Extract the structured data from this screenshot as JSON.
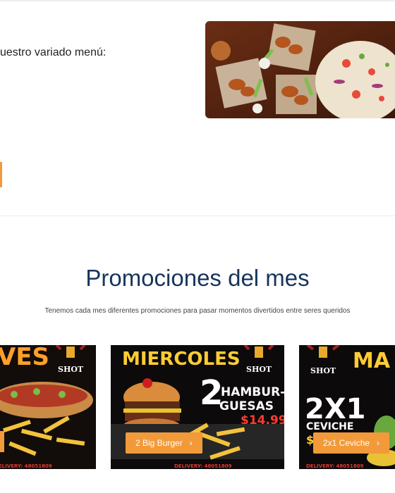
{
  "intro": {
    "menu_text": "uestro variado menú:"
  },
  "promotions": {
    "title": "Promociones del mes",
    "subtitle": "Tenemos cada mes diferentes promociones para pasar momentos divertidos entre seres queridos"
  },
  "cards": [
    {
      "headline": "VES",
      "brand": "SHOT",
      "footer": "ELIVERY: 48051809"
    },
    {
      "headline": "MIERCOLES",
      "brand": "SHOT",
      "promo_big": "2",
      "promo_line1": "HAMBUR-",
      "promo_line2": "GUESAS",
      "price": "$14.99",
      "button_label": "2 Big Burger",
      "footer": "DELIVERY: 48051809"
    },
    {
      "headline": "MA",
      "brand": "SHOT",
      "promo_big": "2X1",
      "promo_line1": "CEVICHE",
      "price_partial": "$",
      "button_label": "2x1 Ceviche",
      "footer": "DELIVERY: 48051809"
    }
  ],
  "colors": {
    "accent": "#f29a3a",
    "title": "#17355c",
    "neon": "#ffcc33",
    "price": "#ff3b2f"
  },
  "icons": {
    "chevron": "chevron-right-icon"
  }
}
